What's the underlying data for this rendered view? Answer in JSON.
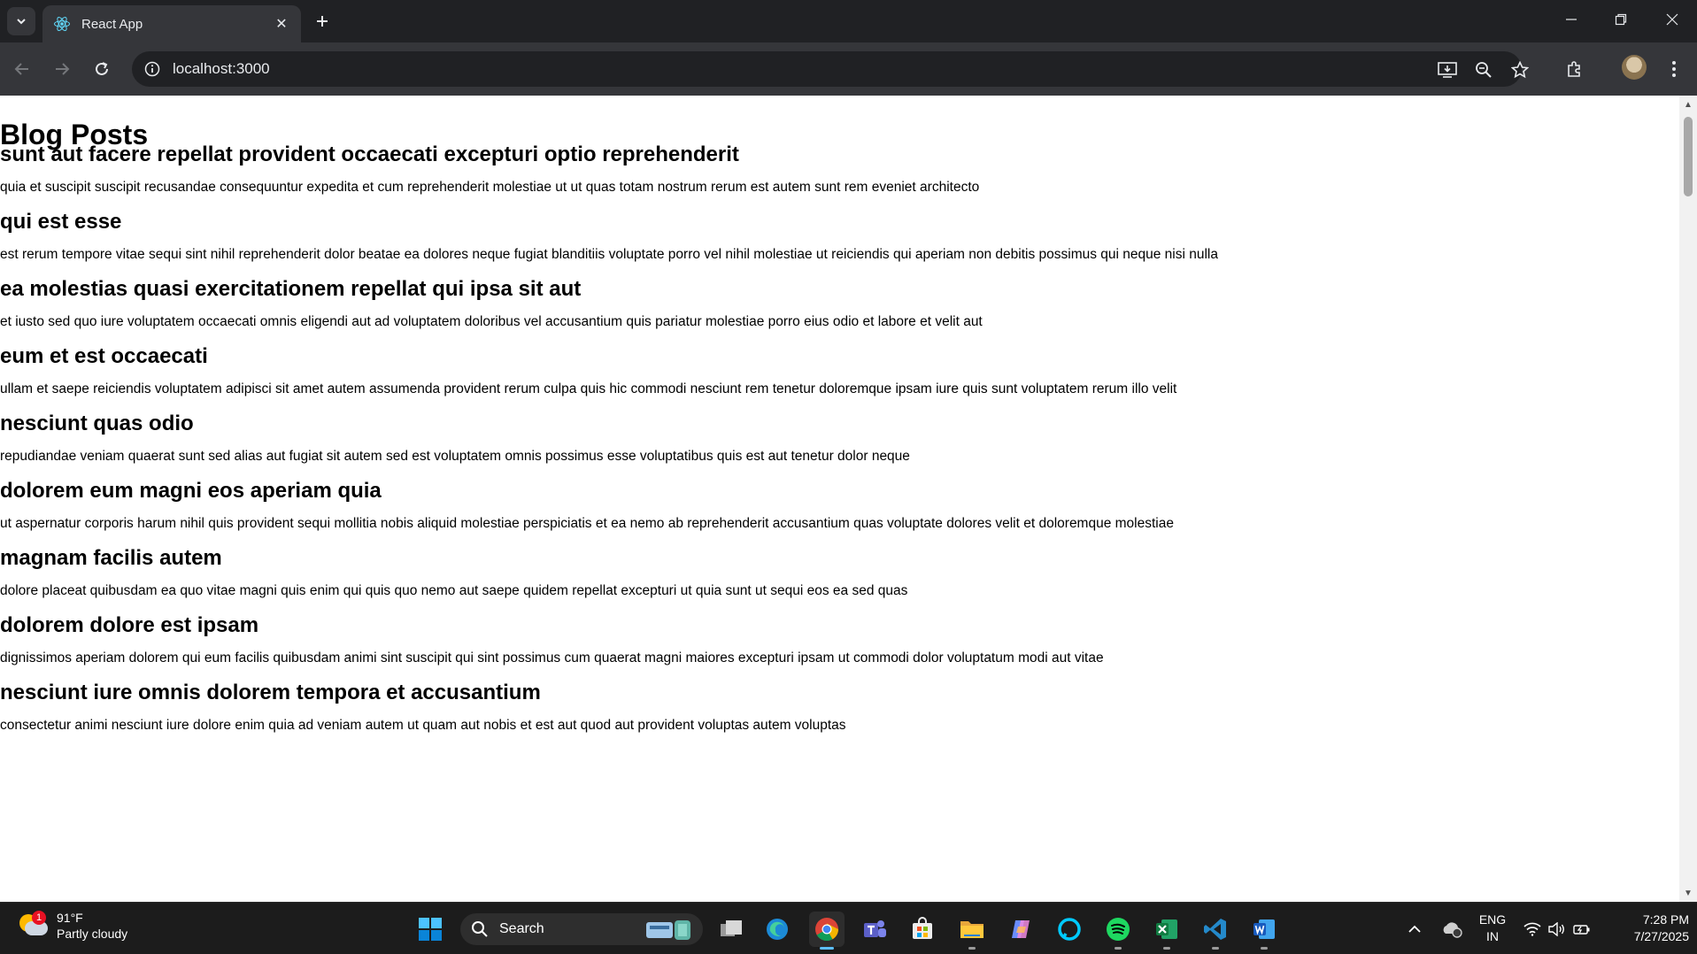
{
  "browser": {
    "tab_title": "React App",
    "url": "localhost:3000"
  },
  "page": {
    "heading": "Blog Posts",
    "posts": [
      {
        "title": "sunt aut facere repellat provident occaecati excepturi optio reprehenderit",
        "body": "quia et suscipit suscipit recusandae consequuntur expedita et cum reprehenderit molestiae ut ut quas totam nostrum rerum est autem sunt rem eveniet architecto"
      },
      {
        "title": "qui est esse",
        "body": "est rerum tempore vitae sequi sint nihil reprehenderit dolor beatae ea dolores neque fugiat blanditiis voluptate porro vel nihil molestiae ut reiciendis qui aperiam non debitis possimus qui neque nisi nulla"
      },
      {
        "title": "ea molestias quasi exercitationem repellat qui ipsa sit aut",
        "body": "et iusto sed quo iure voluptatem occaecati omnis eligendi aut ad voluptatem doloribus vel accusantium quis pariatur molestiae porro eius odio et labore et velit aut"
      },
      {
        "title": "eum et est occaecati",
        "body": "ullam et saepe reiciendis voluptatem adipisci sit amet autem assumenda provident rerum culpa quis hic commodi nesciunt rem tenetur doloremque ipsam iure quis sunt voluptatem rerum illo velit"
      },
      {
        "title": "nesciunt quas odio",
        "body": "repudiandae veniam quaerat sunt sed alias aut fugiat sit autem sed est voluptatem omnis possimus esse voluptatibus quis est aut tenetur dolor neque"
      },
      {
        "title": "dolorem eum magni eos aperiam quia",
        "body": "ut aspernatur corporis harum nihil quis provident sequi mollitia nobis aliquid molestiae perspiciatis et ea nemo ab reprehenderit accusantium quas voluptate dolores velit et doloremque molestiae"
      },
      {
        "title": "magnam facilis autem",
        "body": "dolore placeat quibusdam ea quo vitae magni quis enim qui quis quo nemo aut saepe quidem repellat excepturi ut quia sunt ut sequi eos ea sed quas"
      },
      {
        "title": "dolorem dolore est ipsam",
        "body": "dignissimos aperiam dolorem qui eum facilis quibusdam animi sint suscipit qui sint possimus cum quaerat magni maiores excepturi ipsam ut commodi dolor voluptatum modi aut vitae"
      },
      {
        "title": "nesciunt iure omnis dolorem tempora et accusantium",
        "body": "consectetur animi nesciunt iure dolore enim quia ad veniam autem ut quam aut nobis et est aut quod aut provident voluptas autem voluptas"
      }
    ]
  },
  "taskbar": {
    "weather_temp": "91°F",
    "weather_condition": "Partly cloudy",
    "weather_badge": "1",
    "search_label": "Search",
    "language_line1": "ENG",
    "language_line2": "IN",
    "time": "7:28 PM",
    "date": "7/27/2025"
  },
  "colors": {
    "chrome_dark": "#202124",
    "chrome_toolbar": "#35363a",
    "page_bg": "#ffffff",
    "taskbar_bg": "#1c1c1c",
    "accent": "#5cc0ff"
  }
}
